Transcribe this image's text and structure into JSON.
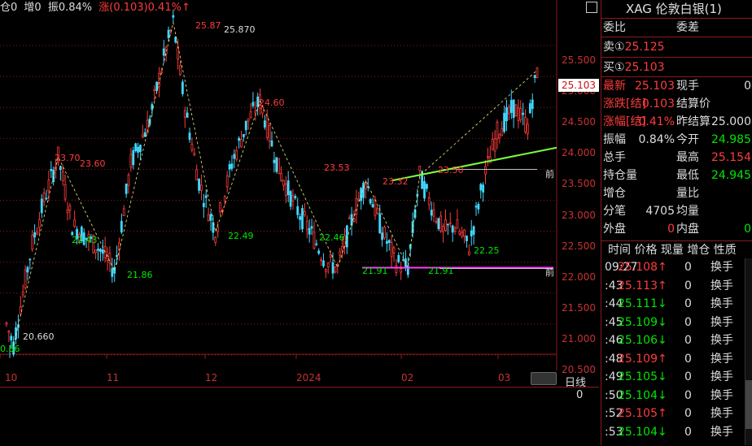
{
  "topbar": {
    "pos": "仓0",
    "inc": "增0",
    "amp": "振0.84%",
    "chg": "涨(0.103)0.41%↑"
  },
  "side": {
    "title": "XAG 伦敦白银(1)",
    "weibi": "委比",
    "weicha": "委差",
    "sell_label": "卖①",
    "sell_value": "25.125",
    "buy_label": "买①",
    "buy_value": "25.103",
    "r1": {
      "l1": "最新",
      "v1": "25.103",
      "l2": "现手",
      "v2": "0"
    },
    "r2": {
      "l1": "涨跌[结]",
      "v1": "0.103",
      "l2": "结算价",
      "v2": ""
    },
    "r3": {
      "l1": "涨幅[结]",
      "v1": "0.41%",
      "l2": "昨结算",
      "v2": "25.000"
    },
    "r4": {
      "l1": "振幅",
      "v1": "0.84%",
      "l2": "今开",
      "v2": "24.985"
    },
    "r5": {
      "l1": "总手",
      "v1": "",
      "l2": "最高",
      "v2": "25.154"
    },
    "r6": {
      "l1": "持仓量",
      "v1": "",
      "l2": "最低",
      "v2": "24.945"
    },
    "r7": {
      "l1": "增仓",
      "v1": "",
      "l2": "量比",
      "v2": ""
    },
    "r8": {
      "l1": "分笔",
      "v1": "4705",
      "l2": "均量",
      "v2": ""
    },
    "r9": {
      "l1": "外盘",
      "v1": "0",
      "l2": "内盘",
      "v2": "0"
    },
    "tick_header": "时间 价格 现量 增仓 性质",
    "ticks": [
      {
        "t": "09:27",
        "p": "25.108↑",
        "v": "0",
        "n": "换手",
        "c": "red"
      },
      {
        "t": ":43",
        "p": "25.113↑",
        "v": "0",
        "n": "换手",
        "c": "red"
      },
      {
        "t": ":44",
        "p": "25.111↓",
        "v": "0",
        "n": "换手",
        "c": "green"
      },
      {
        "t": ":45",
        "p": "25.109↓",
        "v": "0",
        "n": "换手",
        "c": "green"
      },
      {
        "t": ":46",
        "p": "25.106↓",
        "v": "0",
        "n": "换手",
        "c": "green"
      },
      {
        "t": ":48",
        "p": "25.109↑",
        "v": "0",
        "n": "换手",
        "c": "red"
      },
      {
        "t": ":49",
        "p": "25.105↓",
        "v": "0",
        "n": "换手",
        "c": "green"
      },
      {
        "t": ":50",
        "p": "25.104↓",
        "v": "0",
        "n": "换手",
        "c": "green"
      },
      {
        "t": ":52",
        "p": "25.105↑",
        "v": "0",
        "n": "换手",
        "c": "red"
      },
      {
        "t": ":53",
        "p": "25.104↓",
        "v": "0",
        "n": "换手",
        "c": "green"
      }
    ]
  },
  "chart": {
    "price_tag": "25.103",
    "yticks": [
      "25.500",
      "25.000",
      "24.500",
      "24.000",
      "23.500",
      "23.000",
      "22.500",
      "22.000",
      "21.500",
      "21.000",
      "20.500"
    ],
    "xticks": [
      "10",
      "11",
      "12",
      "2024",
      "02",
      "03"
    ],
    "labels": {
      "high": "25.870",
      "low": "20.660",
      "low_short": "0.66",
      "peak_top": "25.87",
      "a1": "23.70",
      "a2": "23.60",
      "a3": "24.60",
      "a4": "23.53",
      "a5": "23.32",
      "a6": "23.50",
      "b1": "22.43",
      "b2": "21.86",
      "b3": "22.49",
      "b4": "22.46",
      "b5": "21.91",
      "b6": "21.91",
      "b7": "22.25",
      "front1": "前",
      "front2": "前"
    }
  },
  "bottom": {
    "label": "日线",
    "value": "0"
  },
  "colors": {
    "up": "#ff3c3c",
    "down": "#40d8ff",
    "green": "#00e600",
    "trend": "#7cff3c",
    "support": "#ff3cff",
    "axis": "#c83232"
  }
}
